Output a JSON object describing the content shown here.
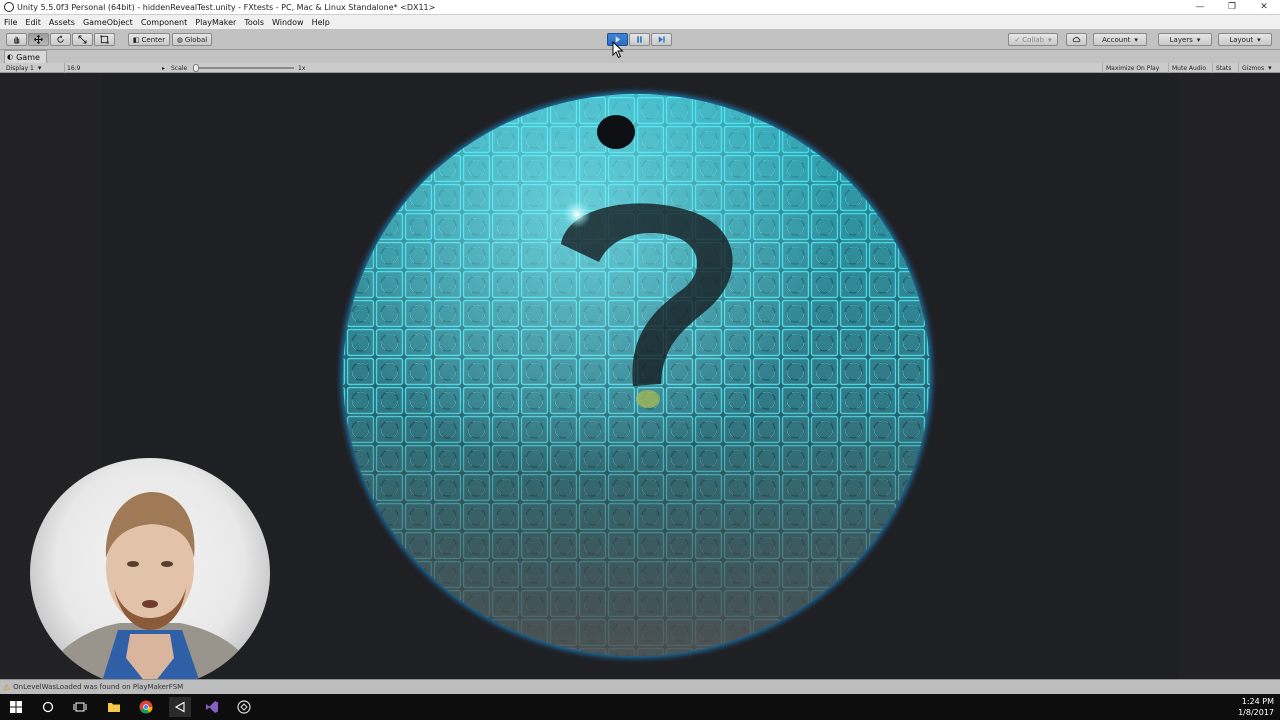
{
  "titlebar": {
    "title": "Unity 5.5.0f3 Personal (64bit) - hiddenRevealTest.unity - FXtests - PC, Mac & Linux Standalone* <DX11>",
    "minimize": "—",
    "restore": "❐",
    "close": "✕"
  },
  "menubar": {
    "items": [
      "File",
      "Edit",
      "Assets",
      "GameObject",
      "Component",
      "PlayMaker",
      "Tools",
      "Window",
      "Help"
    ]
  },
  "toolbar": {
    "pivot_label": "Center",
    "space_label": "Global",
    "collab_label": "Collab",
    "account_label": "Account",
    "layers_label": "Layers",
    "layout_label": "Layout",
    "play_active": true
  },
  "game_view": {
    "tab_label": "Game",
    "display_label": "Display 1",
    "aspect_label": "16:9",
    "scale_label": "Scale",
    "scale_value": "1x",
    "maximize_on_play": "Maximize On Play",
    "mute_audio": "Mute Audio",
    "stats": "Stats",
    "gizmos": "Gizmos"
  },
  "statusbar": {
    "message": "OnLevelWasLoaded was found on PlayMakerFSM"
  },
  "taskbar": {
    "time": "1:24 PM",
    "date": "1/8/2017"
  },
  "colors": {
    "tile_glow": "#39d4e6",
    "disc_rim": "#1c78b0",
    "play_active": "#2b6fc4"
  }
}
